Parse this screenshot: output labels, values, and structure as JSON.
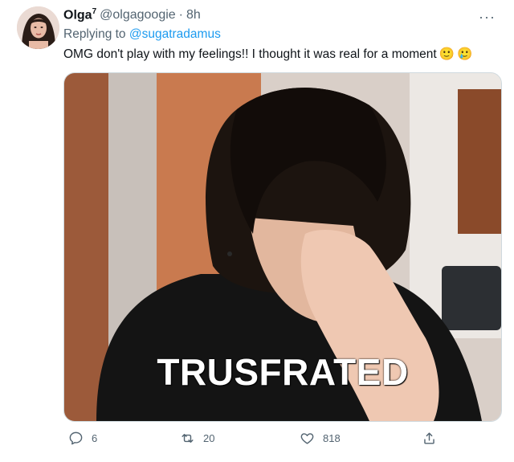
{
  "tweet": {
    "author_name": "Olga",
    "author_sup": "7",
    "handle": "@olgagoogie",
    "separator": "·",
    "time": "8h",
    "more_label": "···",
    "reply_prefix": "Replying to",
    "reply_to": "@sugatradamus",
    "text": "OMG don't play with my feelings!! I thought it was real for a moment",
    "emojis": [
      "🙂",
      "🥲"
    ],
    "image_caption": "TRUSFRATED",
    "reply_count": "6",
    "retweet_count": "20",
    "like_count": "818"
  }
}
